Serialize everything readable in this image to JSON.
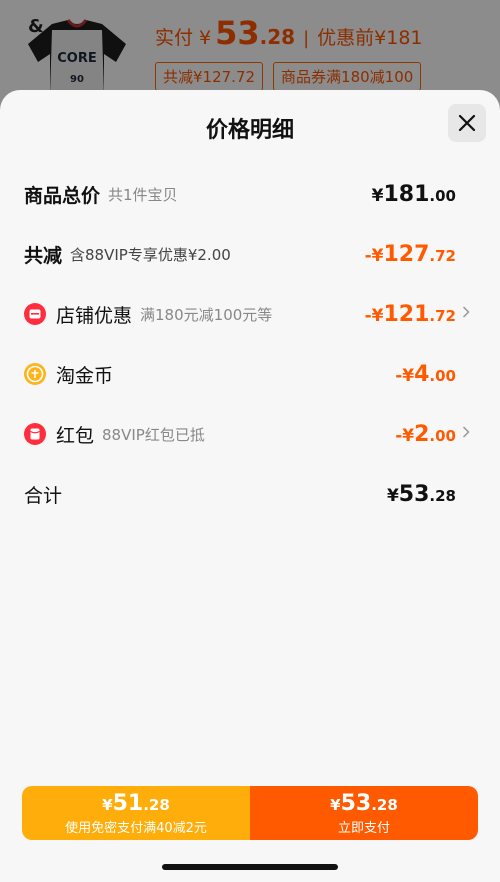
{
  "product": {
    "brand_mark": "&",
    "shirt_text": "CORE",
    "shirt_number": "90",
    "paid_label": "实付",
    "paid_yen": "¥",
    "paid_int": "53",
    "paid_dec": ".28",
    "separator": "|",
    "original_label": "优惠前¥181",
    "chip_total_discount": "共减¥127.72",
    "chip_coupon": "商品券满180减100"
  },
  "sheet": {
    "title": "价格明细",
    "rows": [
      {
        "name": "商品总价",
        "sub": "共1件宝贝",
        "yen": "¥",
        "int": "181",
        "dec": ".00"
      },
      {
        "name": "共减",
        "sub": "含88VIP专享优惠¥2.00",
        "yen": "-¥",
        "int": "127",
        "dec": ".72"
      },
      {
        "name": "店铺优惠",
        "sub": "满180元减100元等",
        "yen": "-¥",
        "int": "121",
        "dec": ".72"
      },
      {
        "name": "淘金币",
        "sub": "",
        "yen": "-¥",
        "int": "4",
        "dec": ".00"
      },
      {
        "name": "红包",
        "sub": "88VIP红包已抵",
        "yen": "-¥",
        "int": "2",
        "dec": ".00"
      },
      {
        "name": "合计",
        "sub": "",
        "yen": "¥",
        "int": "53",
        "dec": ".28"
      }
    ]
  },
  "buttons": {
    "left": {
      "yen": "¥",
      "int": "51",
      "dec": ".28",
      "caption": "使用免密支付满40减2元"
    },
    "right": {
      "yen": "¥",
      "int": "53",
      "dec": ".28",
      "caption": "立即支付"
    }
  },
  "colors": {
    "accent": "#ff5a00",
    "secondary": "#ffad0a",
    "sheet_bg": "#f7f7f7"
  }
}
